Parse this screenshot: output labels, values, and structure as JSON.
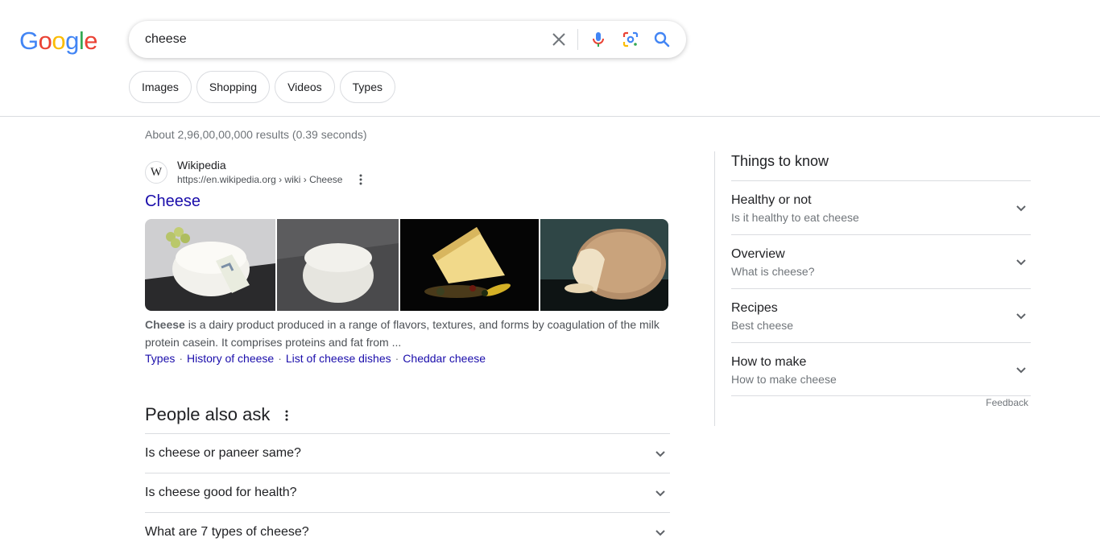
{
  "logo": {
    "letters": [
      "G",
      "o",
      "o",
      "g",
      "l",
      "e"
    ],
    "colors": [
      "#4285F4",
      "#EA4335",
      "#FBBC05",
      "#4285F4",
      "#34A853",
      "#EA4335"
    ]
  },
  "search": {
    "value": "cheese",
    "clear_icon": "close-icon",
    "mic_icon": "mic-icon",
    "lens_icon": "lens-icon",
    "search_icon": "search-icon"
  },
  "chips": [
    "Images",
    "Shopping",
    "Videos",
    "Types"
  ],
  "results": {
    "stats": "About 2,96,00,00,000 results (0.39 seconds)",
    "first": {
      "favicon": "W",
      "site_name": "Wikipedia",
      "url": "https://en.wikipedia.org › wiki › Cheese",
      "title": "Cheese",
      "snippet_bold": "Cheese",
      "snippet_rest": " is a dairy product produced in a range of flavors, textures, and forms by coagulation of the milk protein casein. It comprises proteins and fat from ...",
      "sitelinks": [
        "Types",
        "History of cheese",
        "List of cheese dishes",
        "Cheddar cheese"
      ],
      "sitelink_sep": "·"
    }
  },
  "people_also_ask": {
    "title": "People also ask",
    "questions": [
      "Is cheese or paneer same?",
      "Is cheese good for health?",
      "What are 7 types of cheese?"
    ]
  },
  "things_to_know": {
    "title": "Things to know",
    "items": [
      {
        "heading": "Healthy or not",
        "sub": "Is it healthy to eat cheese"
      },
      {
        "heading": "Overview",
        "sub": "What is cheese?"
      },
      {
        "heading": "Recipes",
        "sub": "Best cheese"
      },
      {
        "heading": "How to make",
        "sub": "How to make cheese"
      }
    ],
    "feedback": "Feedback"
  },
  "colors": {
    "link": "#1a0dab",
    "border": "#dadce0",
    "muted": "#70757a"
  }
}
